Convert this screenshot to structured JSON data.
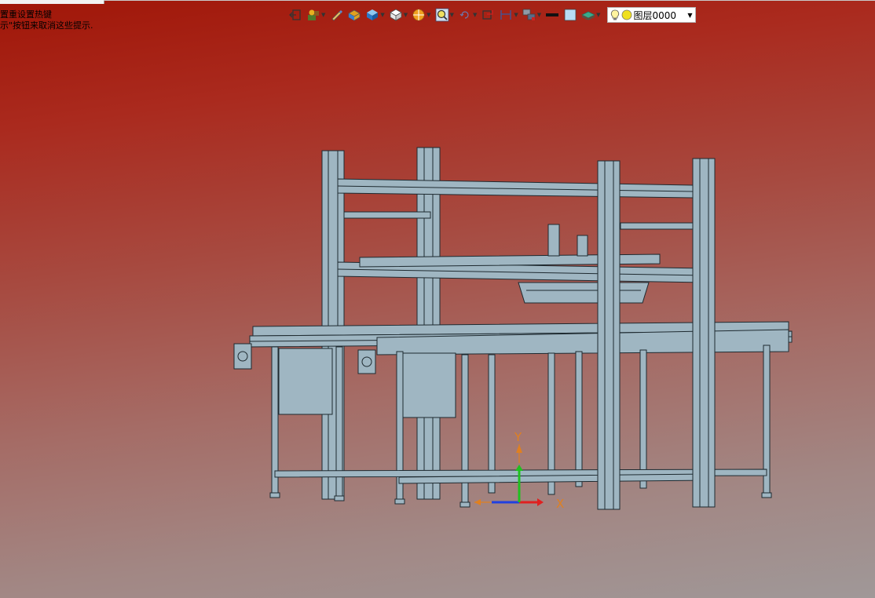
{
  "app": {
    "hint_line1": "置重设置热键",
    "hint_line2": "示\"按钮来取消这些提示."
  },
  "toolbar": {
    "items": [
      {
        "icon": "exit-icon"
      },
      {
        "icon": "assembly-icon"
      },
      {
        "icon": "pencil-icon"
      },
      {
        "icon": "part-icon"
      },
      {
        "icon": "solid-box-icon"
      },
      {
        "icon": "view-cube-icon"
      },
      {
        "icon": "render-mode-icon"
      },
      {
        "icon": "zoom-icon"
      },
      {
        "icon": "rotate-icon"
      },
      {
        "icon": "snap-icon"
      },
      {
        "icon": "measure-icon"
      },
      {
        "icon": "display-icon"
      },
      {
        "icon": "line-color-icon"
      },
      {
        "icon": "fill-color-icon"
      },
      {
        "icon": "layer-stack-icon"
      }
    ],
    "layer_value": "图层0000"
  },
  "viewport": {
    "axis_y": "Y",
    "axis_x": "X",
    "colors": {
      "background_top": "#a01608",
      "background_bottom": "#a09898",
      "model_fill": "#9fb6c2",
      "model_stroke": "#1e2a30",
      "axis_x": "#e02020",
      "axis_y": "#20c020",
      "axis_z": "#2040e0"
    }
  }
}
